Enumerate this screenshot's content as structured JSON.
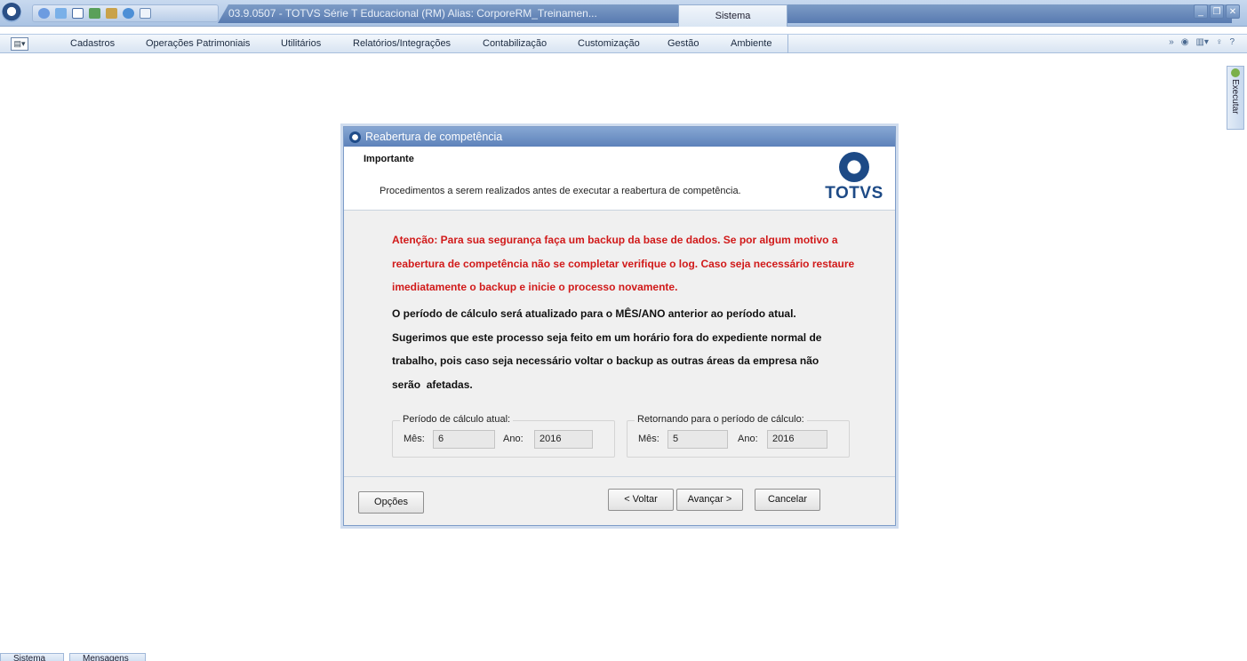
{
  "window": {
    "title": "03.9.0507 - TOTVS Série T Educacional (RM) Alias: CorporeRM_Treinamen...",
    "context_tab": "Sistema"
  },
  "menu": {
    "items": [
      "Cadastros",
      "Operações Patrimoniais",
      "Utilitários",
      "Relatórios/Integrações",
      "Contabilização",
      "Customização",
      "Gestão",
      "Ambiente"
    ]
  },
  "side_tab": {
    "label": "Executar"
  },
  "dialog": {
    "title": "Reabertura de competência",
    "header_title": "Importante",
    "header_description": "Procedimentos a serem realizados antes de executar a reabertura de competência.",
    "logo_text": "TOTVS",
    "warning_lines": [
      "Atenção: Para sua segurança faça um backup da base de dados. Se por algum motivo a",
      "reabertura de competência não se completar verifique o log. Caso seja necessário restaure",
      "imediatamente o backup e inicie o processo novamente."
    ],
    "info_lines": [
      "O período de cálculo será atualizado para o MÊS/ANO anterior ao período atual.",
      "Sugerimos que este processo seja feito em um horário fora do expediente normal de",
      "trabalho, pois caso seja necessário voltar o backup as outras áreas da empresa não",
      "serão  afetadas."
    ],
    "current_period": {
      "legend": "Período de cálculo atual:",
      "month_label": "Mês:",
      "month_value": "6",
      "year_label": "Ano:",
      "year_value": "2016"
    },
    "return_period": {
      "legend": "Retornando para o período de cálculo:",
      "month_label": "Mês:",
      "month_value": "5",
      "year_label": "Ano:",
      "year_value": "2016"
    },
    "buttons": {
      "options": "Opções",
      "back": "< Voltar",
      "next": "Avançar >",
      "cancel": "Cancelar"
    }
  },
  "bottom_tabs": [
    "Sistema",
    "Mensagens"
  ]
}
